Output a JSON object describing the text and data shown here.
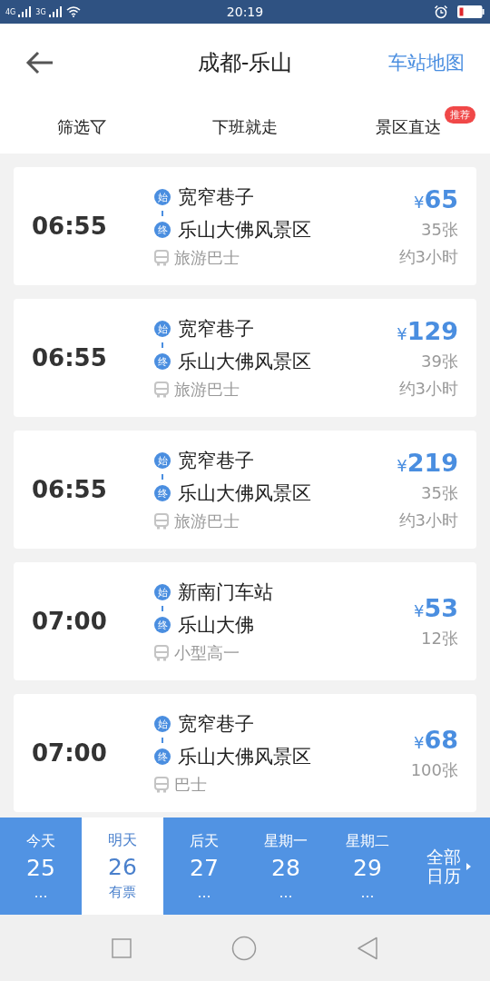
{
  "status_bar": {
    "network_1": "4G",
    "network_2": "3G",
    "time": "20:19"
  },
  "header": {
    "title": "成都-乐山",
    "action": "车站地图"
  },
  "filters": [
    {
      "label": "筛选",
      "kind": "filter"
    },
    {
      "label": "下班就走",
      "kind": "plain"
    },
    {
      "label": "景区直达",
      "kind": "badge",
      "badge": "推荐"
    }
  ],
  "trips": [
    {
      "time": "06:55",
      "start_mark": "始",
      "start": "宽窄巷子",
      "end_mark": "终",
      "end": "乐山大佛风景区",
      "vehicle": "旅游巴士",
      "currency": "¥",
      "price": "65",
      "tickets": "35张",
      "duration": "约3小时"
    },
    {
      "time": "06:55",
      "start_mark": "始",
      "start": "宽窄巷子",
      "end_mark": "终",
      "end": "乐山大佛风景区",
      "vehicle": "旅游巴士",
      "currency": "¥",
      "price": "129",
      "tickets": "39张",
      "duration": "约3小时"
    },
    {
      "time": "06:55",
      "start_mark": "始",
      "start": "宽窄巷子",
      "end_mark": "终",
      "end": "乐山大佛风景区",
      "vehicle": "旅游巴士",
      "currency": "¥",
      "price": "219",
      "tickets": "35张",
      "duration": "约3小时"
    },
    {
      "time": "07:00",
      "start_mark": "始",
      "start": "新南门车站",
      "end_mark": "终",
      "end": "乐山大佛",
      "vehicle": "小型高一",
      "currency": "¥",
      "price": "53",
      "tickets": "12张"
    },
    {
      "time": "07:00",
      "start_mark": "始",
      "start": "宽窄巷子",
      "end_mark": "终",
      "end": "乐山大佛风景区",
      "vehicle": "巴士",
      "currency": "¥",
      "price": "68",
      "tickets": "100张"
    }
  ],
  "dates": [
    {
      "label": "今天",
      "day": "25",
      "note": "…",
      "selected": false
    },
    {
      "label": "明天",
      "day": "26",
      "note": "有票",
      "selected": true
    },
    {
      "label": "后天",
      "day": "27",
      "note": "…",
      "selected": false
    },
    {
      "label": "星期一",
      "day": "28",
      "note": "…",
      "selected": false
    },
    {
      "label": "星期二",
      "day": "29",
      "note": "…",
      "selected": false
    }
  ],
  "calendar_button": "全部日历"
}
